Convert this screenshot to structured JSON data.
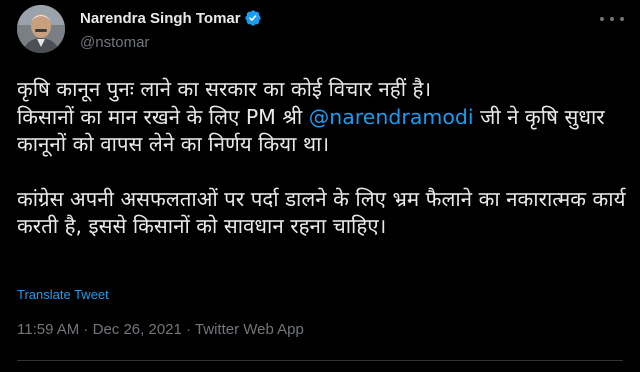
{
  "author": {
    "name": "Narendra Singh Tomar",
    "handle": "@nstomar",
    "verified": true
  },
  "tweet": {
    "line1": "कृषि कानून पुनः लाने का सरकार का कोई विचार नहीं है।",
    "line2_prefix": "किसानों का मान रखने के लिए PM श्री ",
    "mention": "@narendramodi",
    "line2_suffix": " जी ने कृषि सुधार कानूनों को वापस लेने का निर्णय किया था।",
    "paragraph2": "कांग्रेस अपनी असफलताओं पर पर्दा डालने के लिए भ्रम फैलाने का नकारात्मक कार्य करती है, इससे किसानों को सावधान रहना चाहिए।"
  },
  "translate_label": "Translate Tweet",
  "meta": {
    "time": "11:59 AM",
    "separator": " · ",
    "date": "Dec 26, 2021",
    "app": "Twitter Web App"
  },
  "colors": {
    "background": "#000000",
    "text": "#e7e9ea",
    "secondary": "#71767b",
    "accent": "#1d9bf0"
  },
  "icons": {
    "verified": "verified-badge-icon",
    "more": "more-options-icon"
  }
}
